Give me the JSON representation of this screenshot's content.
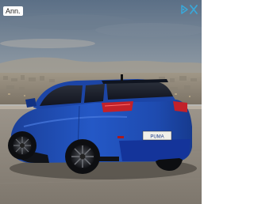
{
  "ad": {
    "label": "Ann.",
    "adchoices_icon": "adchoices-icon",
    "creative": {
      "subject": "car-image",
      "plate_text": "PUMA",
      "car_color": "#1f4fb8"
    }
  }
}
